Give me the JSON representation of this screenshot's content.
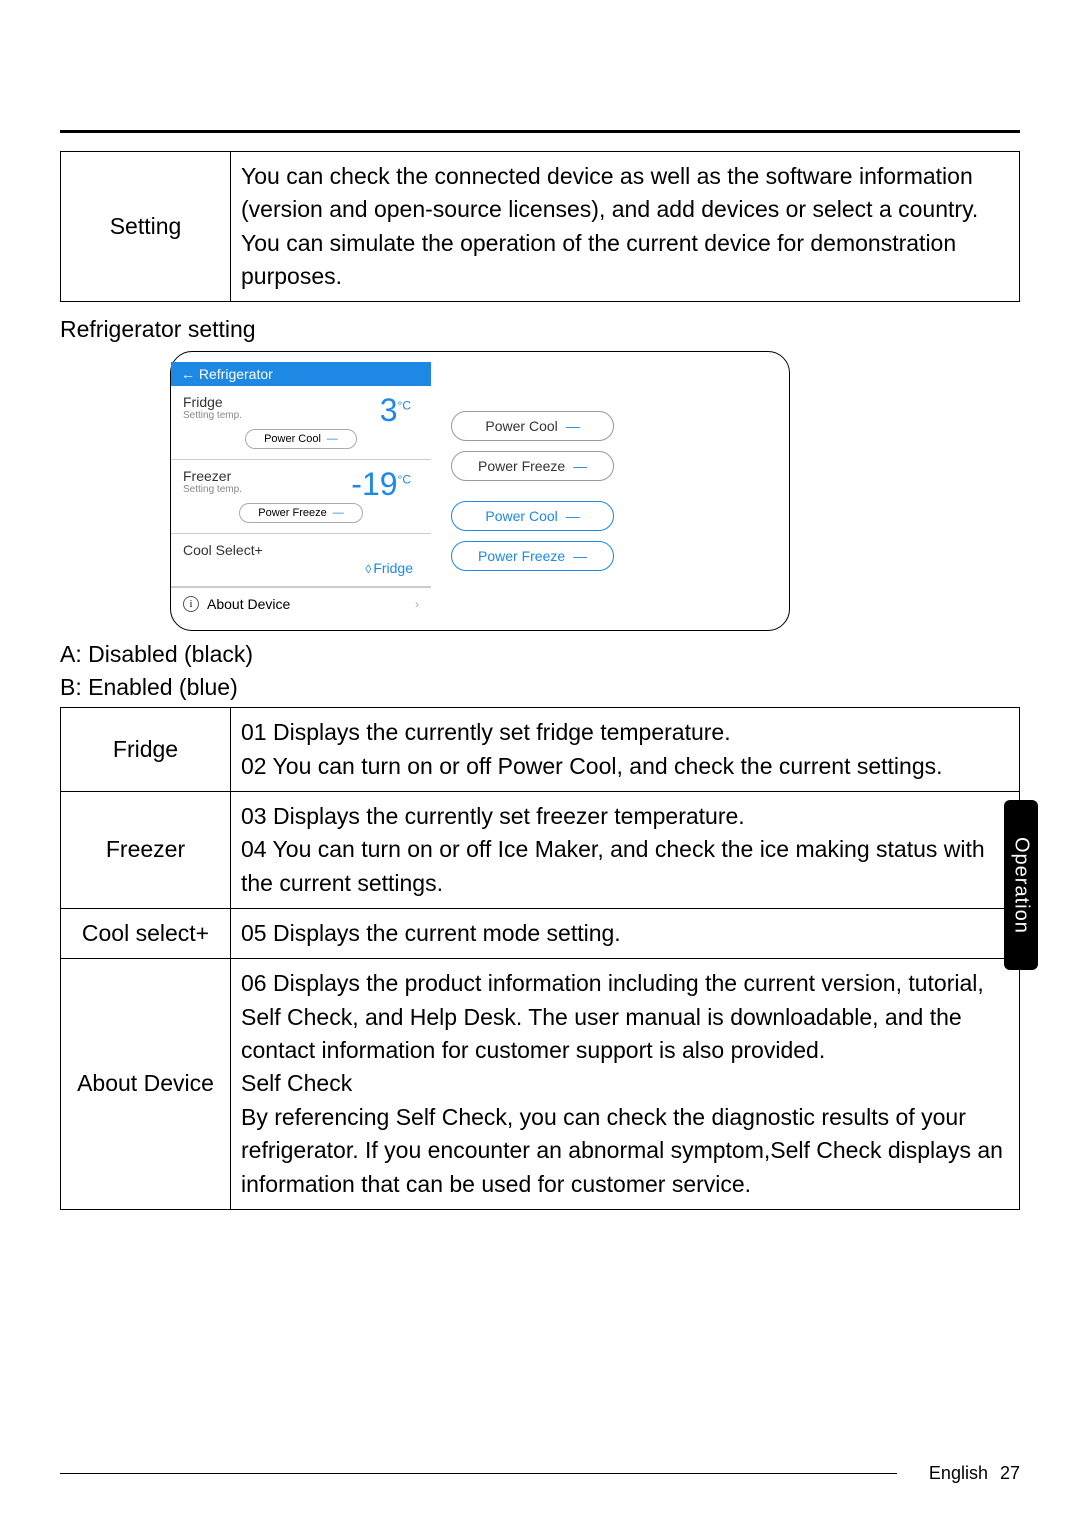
{
  "top_table": {
    "header": "Setting",
    "body": "You can check the connected device as well as the software information (version and open-source licenses), and add devices or select a country.\nYou can simulate the operation of the current device for demonstration purposes."
  },
  "section_heading": "Refrigerator setting",
  "diagram": {
    "screen_title": "←  Refrigerator",
    "fridge_label": "Fridge",
    "setting_temp_label": "Setting temp.",
    "fridge_temp": "3",
    "fridge_unit": "°C",
    "power_cool": "Power Cool",
    "freezer_label": "Freezer",
    "freezer_temp": "-19",
    "freezer_unit": "°C",
    "power_freeze": "Power Freeze",
    "coolselect_label": "Cool Select+",
    "coolselect_value": "Fridge",
    "about_device": "About Device",
    "btn_disabled_cool": "Power Cool",
    "btn_disabled_freeze": "Power Freeze",
    "btn_enabled_cool": "Power Cool",
    "btn_enabled_freeze": "Power Freeze"
  },
  "legend_a": "A: Disabled (black)",
  "legend_b": "B: Enabled (blue)",
  "rows": [
    {
      "name": "Fridge",
      "desc": "01 Displays the currently set fridge temperature.\n02 You can turn on or off Power Cool, and check the current settings."
    },
    {
      "name": "Freezer",
      "desc": "03 Displays the currently set freezer temperature.\n04 You can turn on or off Ice Maker, and check the ice making status with the current settings."
    },
    {
      "name": "Cool select+",
      "desc": "05 Displays the current mode setting."
    },
    {
      "name": "About Device",
      "desc": "06 Displays the product information including the current version, tutorial, Self Check, and Help Desk. The user manual is downloadable, and the contact information for customer support is also provided.\nSelf Check\nBy referencing Self Check, you can check the diagnostic results of your refrigerator. If you encounter an abnormal symptom,Self Check displays an information that can be used for customer service."
    }
  ],
  "side_tab": "Operation",
  "footer_lang": "English",
  "footer_page": "27"
}
